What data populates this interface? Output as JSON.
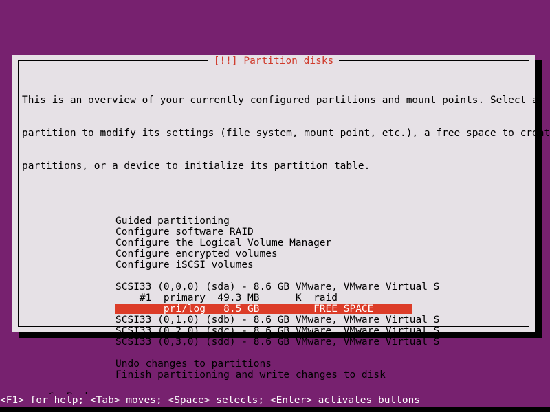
{
  "screen": {
    "background_color": "#77216f",
    "dialog_background_color": "#e6e1e6",
    "highlight_color": "#dc3c28",
    "title_color": "#d03a2b",
    "text_color": "#000000"
  },
  "dialog": {
    "title": "[!!] Partition disks",
    "intro_lines": [
      "This is an overview of your currently configured partitions and mount points. Select a",
      "partition to modify its settings (file system, mount point, etc.), a free space to create",
      "partitions, or a device to initialize its partition table."
    ],
    "actions": [
      {
        "label": "Guided partitioning",
        "selected": false
      },
      {
        "label": "Configure software RAID",
        "selected": false
      },
      {
        "label": "Configure the Logical Volume Manager",
        "selected": false
      },
      {
        "label": "Configure encrypted volumes",
        "selected": false
      },
      {
        "label": "Configure iSCSI volumes",
        "selected": false
      }
    ],
    "devices": [
      {
        "label": "SCSI33 (0,0,0) (sda) - 8.6 GB VMware, VMware Virtual S",
        "selected": false,
        "kind": "device"
      },
      {
        "label": "    #1  primary  49.3 MB      K  raid",
        "selected": false,
        "kind": "partition"
      },
      {
        "label": "        pri/log   8.5 GB         FREE SPACE",
        "selected": true,
        "kind": "free-space"
      },
      {
        "label": "SCSI33 (0,1,0) (sdb) - 8.6 GB VMware, VMware Virtual S",
        "selected": false,
        "kind": "device"
      },
      {
        "label": "SCSI33 (0,2,0) (sdc) - 8.6 GB VMware, VMware Virtual S",
        "selected": false,
        "kind": "device"
      },
      {
        "label": "SCSI33 (0,3,0) (sdd) - 8.6 GB VMware, VMware Virtual S",
        "selected": false,
        "kind": "device"
      }
    ],
    "finish_actions": [
      {
        "label": "Undo changes to partitions",
        "selected": false
      },
      {
        "label": "Finish partitioning and write changes to disk",
        "selected": false
      }
    ],
    "buttons": [
      {
        "label": "<Go Back>",
        "name": "go-back-button"
      }
    ]
  },
  "statusbar": {
    "help_text": "<F1> for help; <Tab> moves; <Space> selects; <Enter> activates buttons"
  }
}
